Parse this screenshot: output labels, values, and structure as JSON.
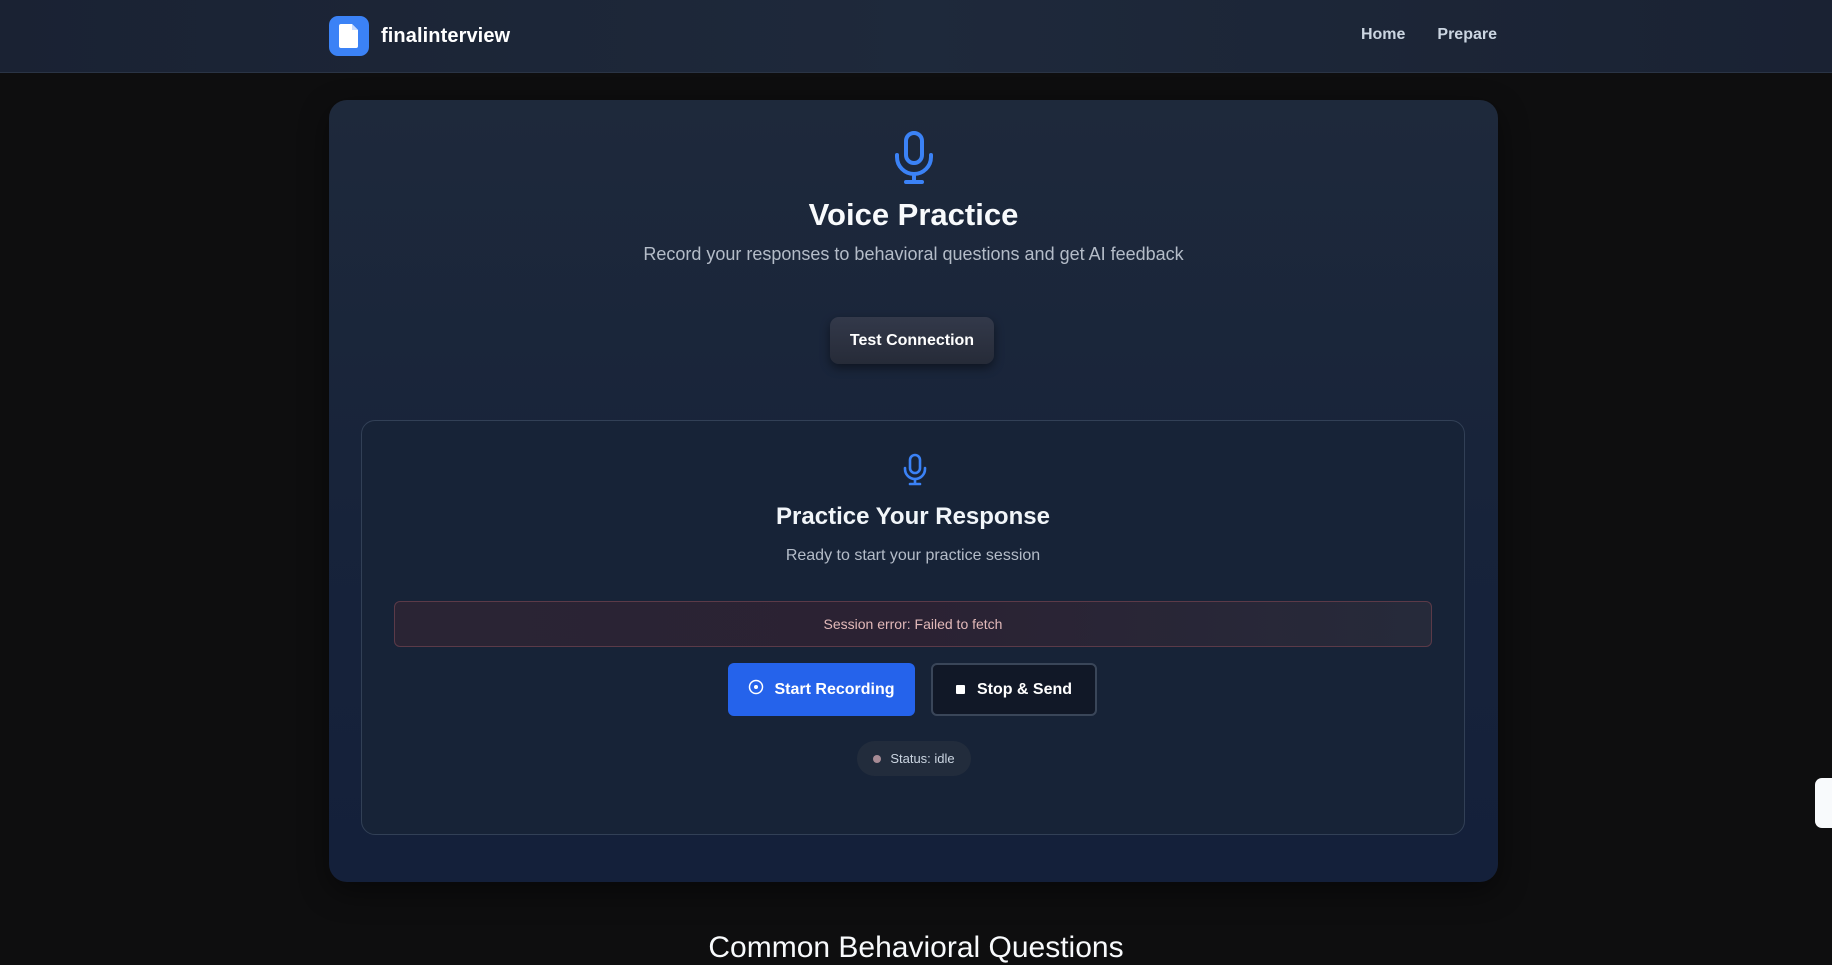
{
  "nav": {
    "brand": "finalinterview",
    "links": [
      {
        "label": "Home"
      },
      {
        "label": "Prepare"
      }
    ]
  },
  "hero": {
    "title": "Voice Practice",
    "subtitle": "Record your responses to behavioral questions and get AI feedback",
    "test_button": "Test Connection",
    "icon": "microphone-icon"
  },
  "practice": {
    "title": "Practice Your Response",
    "subtitle": "Ready to start your practice session",
    "error": "Session error: Failed to fetch",
    "start_button": "Start Recording",
    "stop_button": "Stop & Send",
    "status": "Status: idle",
    "icon": "microphone-icon"
  },
  "section": {
    "heading": "Common Behavioral Questions"
  },
  "colors": {
    "accent": "#3b82f6",
    "primary_button": "#2563eb",
    "background": "#0e0e0f",
    "card": "#1e293b",
    "error_border": "#5b3a48"
  }
}
